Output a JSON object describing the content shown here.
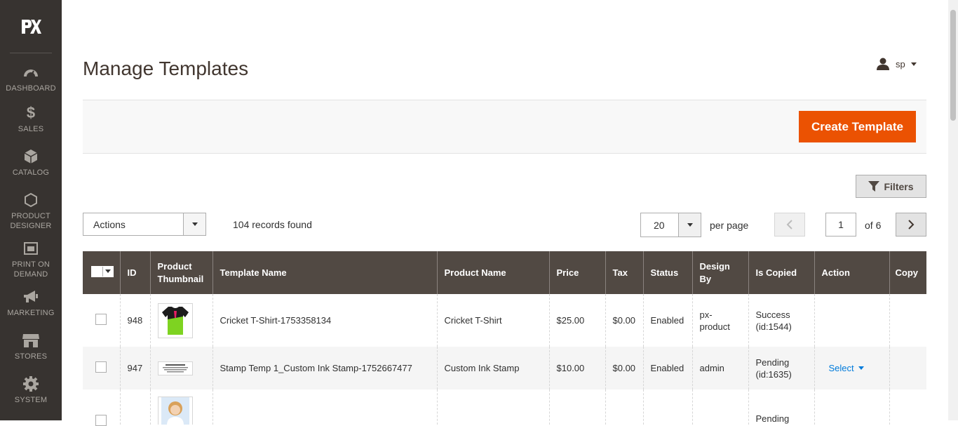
{
  "sidebar": {
    "logo": "PX",
    "items": [
      {
        "label": "DASHBOARD",
        "icon": "dashboard-icon"
      },
      {
        "label": "SALES",
        "icon": "dollar-icon"
      },
      {
        "label": "CATALOG",
        "icon": "cube-icon"
      },
      {
        "label": "PRODUCT DESIGNER",
        "icon": "hexagon-icon"
      },
      {
        "label": "PRINT ON DEMAND",
        "icon": "printer-icon"
      },
      {
        "label": "MARKETING",
        "icon": "megaphone-icon"
      },
      {
        "label": "STORES",
        "icon": "store-icon"
      },
      {
        "label": "SYSTEM",
        "icon": "gear-icon"
      }
    ]
  },
  "header": {
    "title": "Manage Templates",
    "user": "sp"
  },
  "toolbar": {
    "create_label": "Create Template",
    "filters_label": "Filters",
    "actions_value": "Actions",
    "records_found": "104 records found",
    "per_page_value": "20",
    "per_page_label": "per page",
    "page_current": "1",
    "page_of": "of 6"
  },
  "table": {
    "columns": [
      "ID",
      "Product Thumbnail",
      "Template Name",
      "Product Name",
      "Price",
      "Tax",
      "Status",
      "Design By",
      "Is Copied",
      "Action",
      "Copy"
    ],
    "rows": [
      {
        "id": "948",
        "template_name": "Cricket T-Shirt-1753358134",
        "product_name": "Cricket T-Shirt",
        "price": "$25.00",
        "tax": "$0.00",
        "status": "Enabled",
        "design_by": "px-product",
        "is_copied": "Success (id:1544)",
        "action": "",
        "copy": ""
      },
      {
        "id": "947",
        "template_name": "Stamp Temp 1_Custom Ink Stamp-1752667477",
        "product_name": "Custom Ink Stamp",
        "price": "$10.00",
        "tax": "$0.00",
        "status": "Enabled",
        "design_by": "admin",
        "is_copied": "Pending (id:1635)",
        "action": "Select",
        "copy": ""
      },
      {
        "id": "",
        "template_name": "",
        "product_name": "",
        "price": "",
        "tax": "",
        "status": "",
        "design_by": "",
        "is_copied": "Pending",
        "action": "",
        "copy": ""
      }
    ]
  },
  "colors": {
    "sidebar_bg": "#373330",
    "primary": "#eb5202",
    "table_header": "#514943",
    "link": "#007bdb"
  }
}
